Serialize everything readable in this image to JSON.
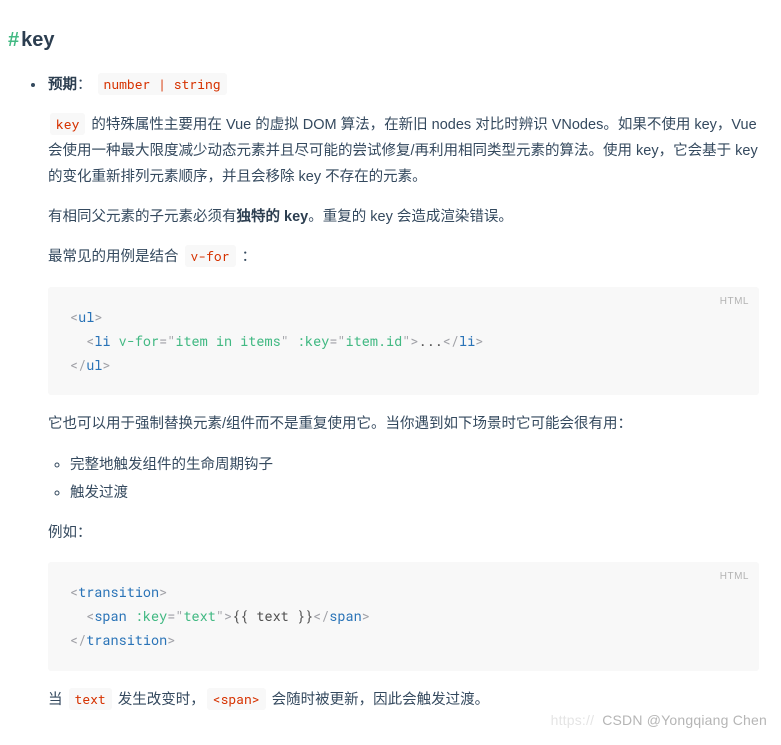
{
  "heading": {
    "hash": "#",
    "text": "key"
  },
  "li": {
    "expects_label": "预期",
    "colon": "：",
    "expects_code": "number | string",
    "para1_code": "key",
    "para1_after": " 的特殊属性主要用在 Vue 的虚拟 DOM 算法，在新旧 nodes 对比时辨识 VNodes。如果不使用 key，Vue 会使用一种最大限度减少动态元素并且尽可能的尝试修复/再利用相同类型元素的算法。使用 key，它会基于 key 的变化重新排列元素顺序，并且会移除 key 不存在的元素。",
    "para2_before": "有相同父元素的子元素必须有",
    "para2_strong": "独特的 key",
    "para2_after": "。重复的 key 会造成渲染错误。",
    "para3_before": "最常见的用例是结合 ",
    "para3_code": "v-for",
    "para3_after": " ：",
    "code1": {
      "lang": "HTML",
      "l1_tag": "ul",
      "l2_indent": "  ",
      "l2_tag": "li",
      "l2_attr1": "v-for",
      "l2_val1": "item in items",
      "l2_attr2": ":key",
      "l2_val2": "item.id",
      "l2_text": "...",
      "l3_tag": "ul"
    },
    "para4": "它也可以用于强制替换元素/组件而不是重复使用它。当你遇到如下场景时它可能会很有用：",
    "bullets": {
      "b1": "完整地触发组件的生命周期钩子",
      "b2": "触发过渡"
    },
    "para5": "例如：",
    "code2": {
      "lang": "HTML",
      "l1_tag": "transition",
      "l2_indent": "  ",
      "l2_tag": "span",
      "l2_attr1": ":key",
      "l2_val1": "text",
      "l2_text": "{{ text }}",
      "l3_tag": "transition"
    },
    "para6_before": "当 ",
    "para6_code1": "text",
    "para6_mid": " 发生改变时，",
    "para6_code2": "<span>",
    "para6_after": " 会随时被更新，因此会触发过渡。"
  },
  "watermark": {
    "faint": "https://",
    "main": "CSDN @Yongqiang Chen"
  }
}
